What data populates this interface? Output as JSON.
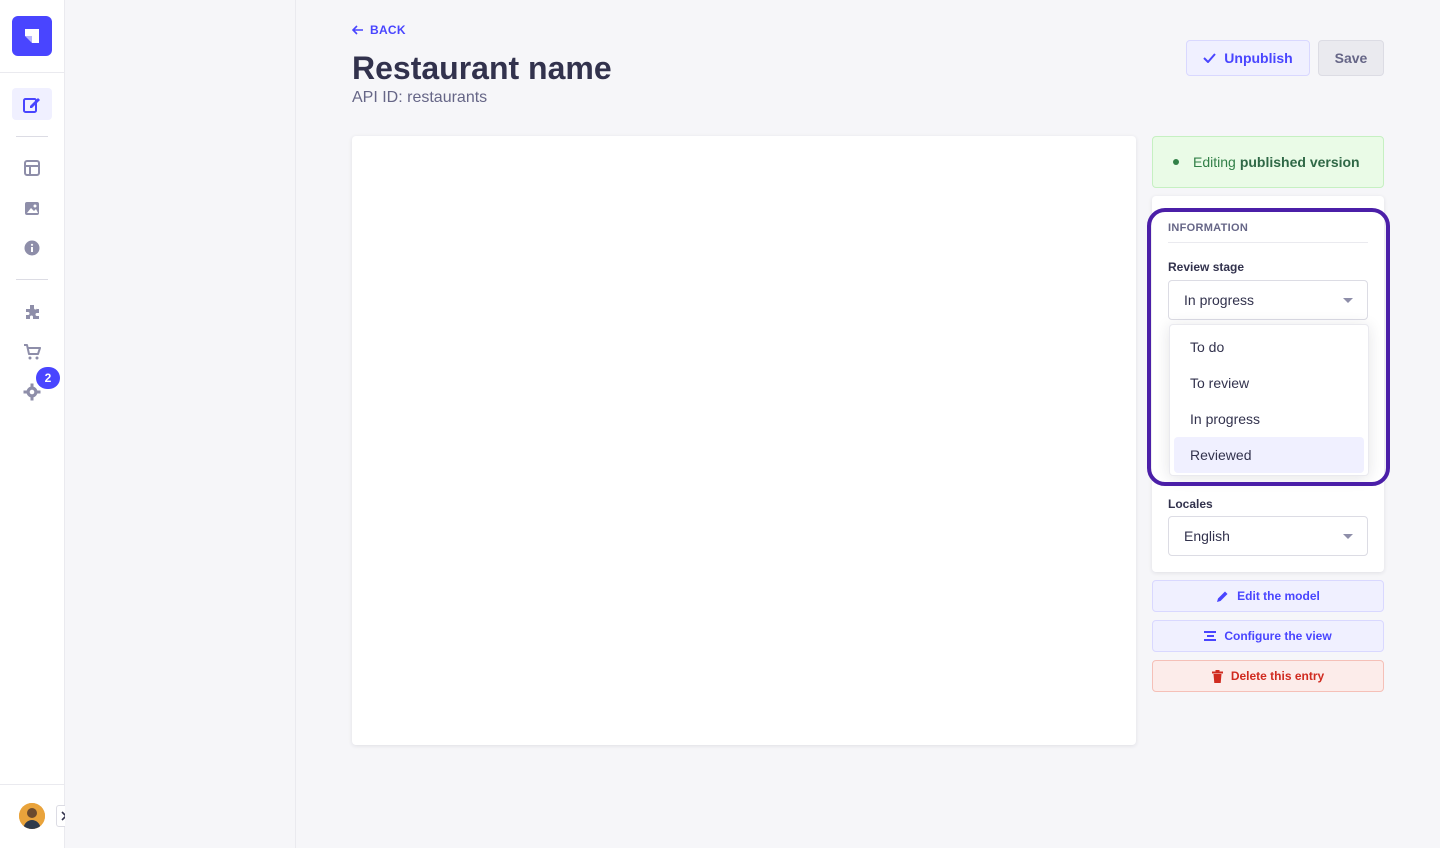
{
  "header": {
    "back_label": "BACK",
    "title": "Restaurant name",
    "subtitle": "API ID: restaurants",
    "unpublish_label": "Unpublish",
    "save_label": "Save"
  },
  "rail": {
    "notification_count": "2"
  },
  "status": {
    "prefix": "Editing",
    "emphasis": "published version"
  },
  "information": {
    "heading": "INFORMATION",
    "review_stage": {
      "label": "Review stage",
      "value": "In progress",
      "options": [
        "To do",
        "To review",
        "In progress",
        "Reviewed"
      ],
      "highlighted": "Reviewed"
    },
    "locales": {
      "label": "Locales",
      "value": "English"
    }
  },
  "actions": {
    "edit_model": "Edit the model",
    "configure_view": "Configure the view",
    "delete_entry": "Delete this entry"
  },
  "colors": {
    "primary": "#4945ff",
    "success": "#328048",
    "danger": "#d02b20",
    "highlight_ring": "#4b1fa8"
  }
}
